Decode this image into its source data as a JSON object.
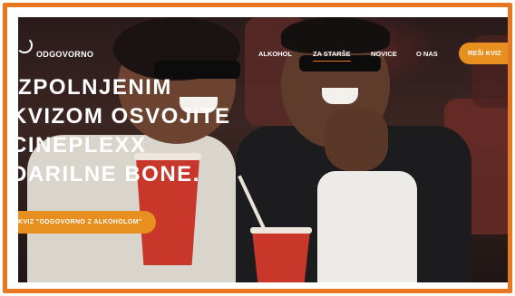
{
  "brand": {
    "name": "ODGOVORNO"
  },
  "nav": {
    "items": [
      {
        "label": "ALKOHOL"
      },
      {
        "label": "ZA STARŠE",
        "active": true
      },
      {
        "label": "NOVICE"
      },
      {
        "label": "O NAS"
      }
    ],
    "cta_label": "REŠI KVIZ"
  },
  "hero": {
    "headline_lines": [
      "IZPOLNJENIM",
      "KVIZOM OSVOJITE",
      "CINEPLEXX",
      "DARILNE BONE."
    ],
    "button_label": "KVIZ \"ODGOVORNO Z ALKOHOLOM\""
  },
  "colors": {
    "border": "#e8771f",
    "accent": "#e8901f",
    "cup": "#c9372b"
  }
}
